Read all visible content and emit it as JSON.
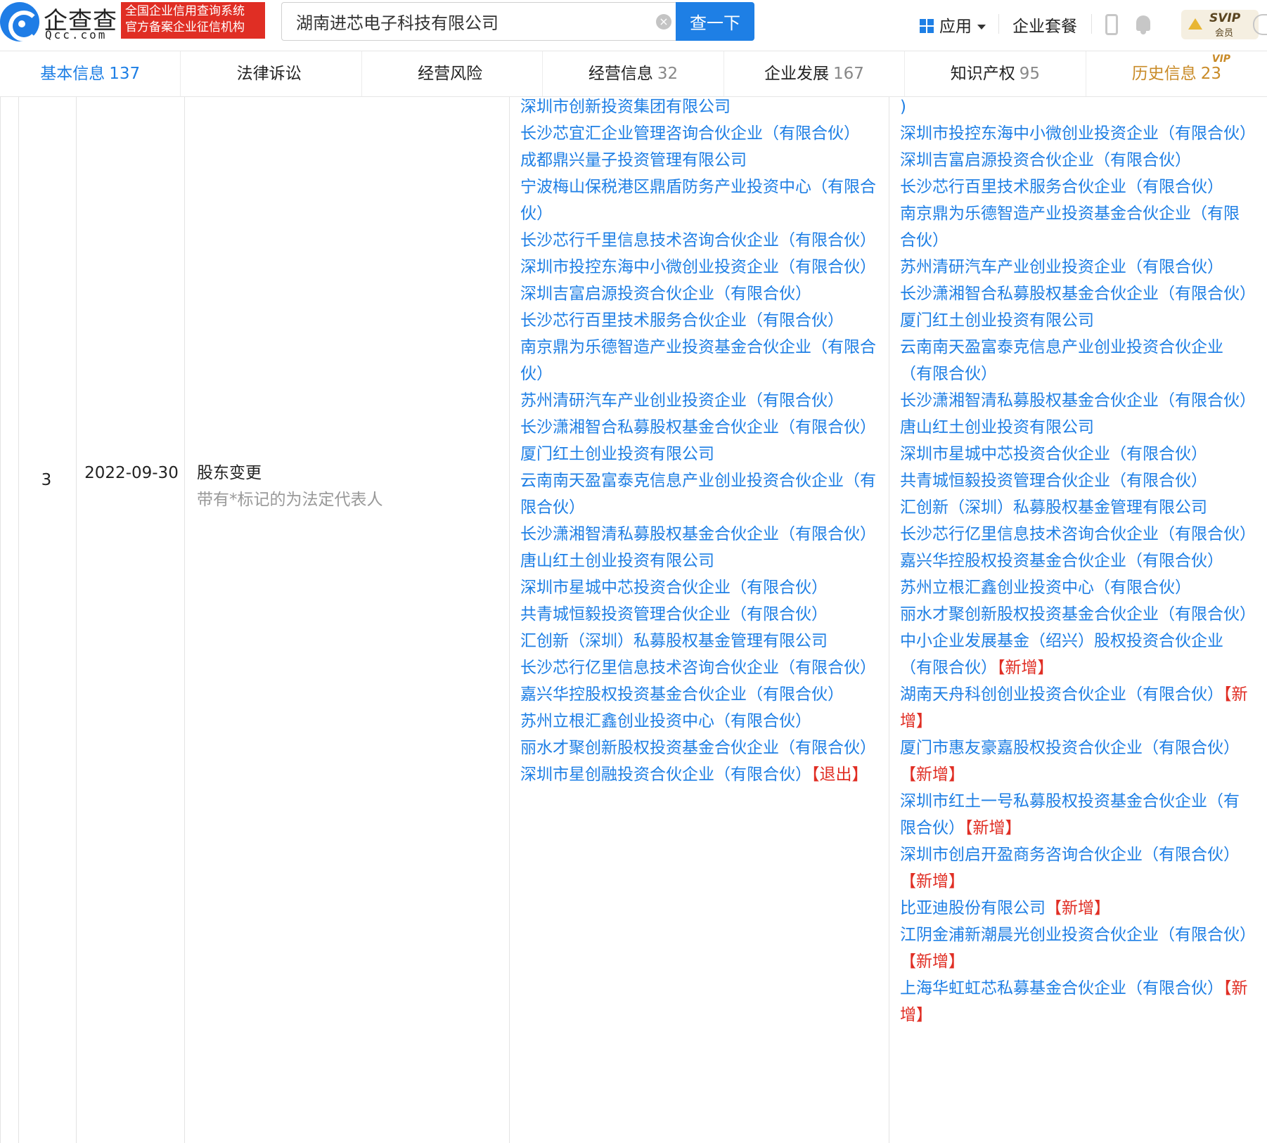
{
  "header": {
    "brand": "企查查",
    "brand_sub": "Qcc.com",
    "badge_line1": "全国企业信用查询系统",
    "badge_line2": "官方备案企业征信机构",
    "search_value": "湖南进芯电子科技有限公司",
    "search_button": "查一下",
    "apps_label": "应用",
    "package_label": "企业套餐",
    "svip_title": "SVIP",
    "svip_sub": "会员"
  },
  "tabs": [
    {
      "label": "基本信息",
      "count": "137"
    },
    {
      "label": "法律诉讼",
      "count": ""
    },
    {
      "label": "经营风险",
      "count": ""
    },
    {
      "label": "经营信息",
      "count": "32"
    },
    {
      "label": "企业发展",
      "count": "167"
    },
    {
      "label": "知识产权",
      "count": "95"
    },
    {
      "label": "历史信息",
      "count": "23",
      "tag": "VIP"
    }
  ],
  "row": {
    "index": "3",
    "date": "2022-09-30",
    "change_type": "股东变更",
    "note": "带有*标记的为法定代表人",
    "before": [
      {
        "name": "深圳市创新投资集团有限公司"
      },
      {
        "name": "长沙芯宜汇企业管理咨询合伙企业（有限合伙）"
      },
      {
        "name": "成都鼎兴量子投资管理有限公司"
      },
      {
        "name": "宁波梅山保税港区鼎盾防务产业投资中心（有限合伙）"
      },
      {
        "name": "长沙芯行千里信息技术咨询合伙企业（有限合伙）"
      },
      {
        "name": "深圳市投控东海中小微创业投资企业（有限合伙）"
      },
      {
        "name": "深圳吉富启源投资合伙企业（有限合伙）"
      },
      {
        "name": "长沙芯行百里技术服务合伙企业（有限合伙）"
      },
      {
        "name": "南京鼎为乐德智造产业投资基金合伙企业（有限合伙）"
      },
      {
        "name": "苏州清研汽车产业创业投资企业（有限合伙）"
      },
      {
        "name": "长沙潇湘智合私募股权基金合伙企业（有限合伙）"
      },
      {
        "name": "厦门红土创业投资有限公司"
      },
      {
        "name": "云南南天盈富泰克信息产业创业投资合伙企业（有限合伙）"
      },
      {
        "name": "长沙潇湘智清私募股权基金合伙企业（有限合伙）"
      },
      {
        "name": "唐山红土创业投资有限公司"
      },
      {
        "name": "深圳市星城中芯投资合伙企业（有限合伙）"
      },
      {
        "name": "共青城恒毅投资管理合伙企业（有限合伙）"
      },
      {
        "name": "汇创新（深圳）私募股权基金管理有限公司"
      },
      {
        "name": "长沙芯行亿里信息技术咨询合伙企业（有限合伙）"
      },
      {
        "name": "嘉兴华控股权投资基金合伙企业（有限合伙）"
      },
      {
        "name": "苏州立根汇鑫创业投资中心（有限合伙）"
      },
      {
        "name": "丽水才聚创新股权投资基金合伙企业（有限合伙）"
      },
      {
        "name": "深圳市星创融投资合伙企业（有限合伙）",
        "tag": "【退出】"
      }
    ],
    "after": [
      {
        "name": ")"
      },
      {
        "name": "深圳市投控东海中小微创业投资企业（有限合伙）"
      },
      {
        "name": "深圳吉富启源投资合伙企业（有限合伙）"
      },
      {
        "name": "长沙芯行百里技术服务合伙企业（有限合伙）"
      },
      {
        "name": "南京鼎为乐德智造产业投资基金合伙企业（有限合伙）"
      },
      {
        "name": "苏州清研汽车产业创业投资企业（有限合伙）"
      },
      {
        "name": "长沙潇湘智合私募股权基金合伙企业（有限合伙）"
      },
      {
        "name": "厦门红土创业投资有限公司"
      },
      {
        "name": "云南南天盈富泰克信息产业创业投资合伙企业（有限合伙）"
      },
      {
        "name": "长沙潇湘智清私募股权基金合伙企业（有限合伙）"
      },
      {
        "name": "唐山红土创业投资有限公司"
      },
      {
        "name": "深圳市星城中芯投资合伙企业（有限合伙）"
      },
      {
        "name": "共青城恒毅投资管理合伙企业（有限合伙）"
      },
      {
        "name": "汇创新（深圳）私募股权基金管理有限公司"
      },
      {
        "name": "长沙芯行亿里信息技术咨询合伙企业（有限合伙）"
      },
      {
        "name": "嘉兴华控股权投资基金合伙企业（有限合伙）"
      },
      {
        "name": "苏州立根汇鑫创业投资中心（有限合伙）"
      },
      {
        "name": "丽水才聚创新股权投资基金合伙企业（有限合伙）"
      },
      {
        "name": "中小企业发展基金（绍兴）股权投资合伙企业（有限合伙）",
        "tag": "【新增】"
      },
      {
        "name": "湖南天舟科创创业投资合伙企业（有限合伙）",
        "tag": "【新增】"
      },
      {
        "name": "厦门市惠友豪嘉股权投资合伙企业（有限合伙）",
        "tag": "【新增】"
      },
      {
        "name": "深圳市红土一号私募股权投资基金合伙企业（有限合伙）",
        "tag": "【新增】"
      },
      {
        "name": "深圳市创启开盈商务咨询合伙企业（有限合伙）",
        "tag": "【新增】"
      },
      {
        "name": "比亚迪股份有限公司",
        "tag": "【新增】"
      },
      {
        "name": "江阴金浦新潮晨光创业投资合伙企业（有限合伙）",
        "tag": "【新增】"
      },
      {
        "name": "上海华虹虹芯私募基金合伙企业（有限合伙）",
        "tag": "【新增】"
      }
    ]
  }
}
